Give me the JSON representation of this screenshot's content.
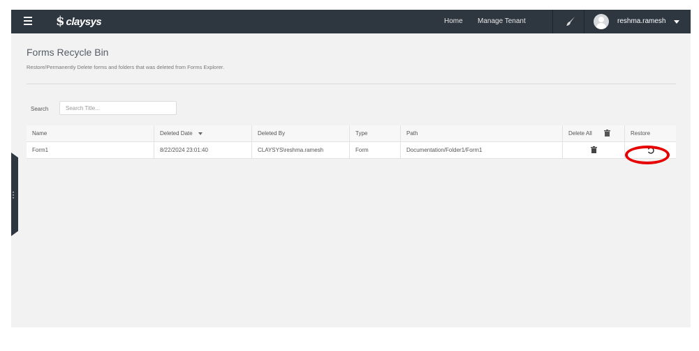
{
  "topbar": {
    "brand": "claysys",
    "nav": {
      "home": "Home",
      "manage_tenant": "Manage Tenant"
    },
    "username": "reshma.ramesh",
    "icons": {
      "menu": "hamburger-icon",
      "theme": "paint-brush-icon",
      "avatar": "user-avatar-icon",
      "user_menu": "chevron-down-icon"
    }
  },
  "page": {
    "title": "Forms Recycle Bin",
    "description": "Restore/Permanently Delete forms and folders that was deleted from Forms Explorer."
  },
  "search": {
    "label": "Search",
    "placeholder": "Search Title...",
    "value": ""
  },
  "table": {
    "columns": {
      "name": "Name",
      "deleted_date": "Deleted Date",
      "deleted_by": "Deleted By",
      "type": "Type",
      "path": "Path",
      "delete_all": "Delete All",
      "restore": "Restore"
    },
    "rows": [
      {
        "name": "Form1",
        "deleted_date": "8/22/2024 23:01:40",
        "deleted_by": "CLAYSYS\\reshma.ramesh",
        "type": "Form",
        "path": "Documentation/Folder1/Form1"
      }
    ]
  },
  "colors": {
    "topbar": "#2e3640",
    "background": "#f2f2f2",
    "highlight": "#e60000"
  }
}
